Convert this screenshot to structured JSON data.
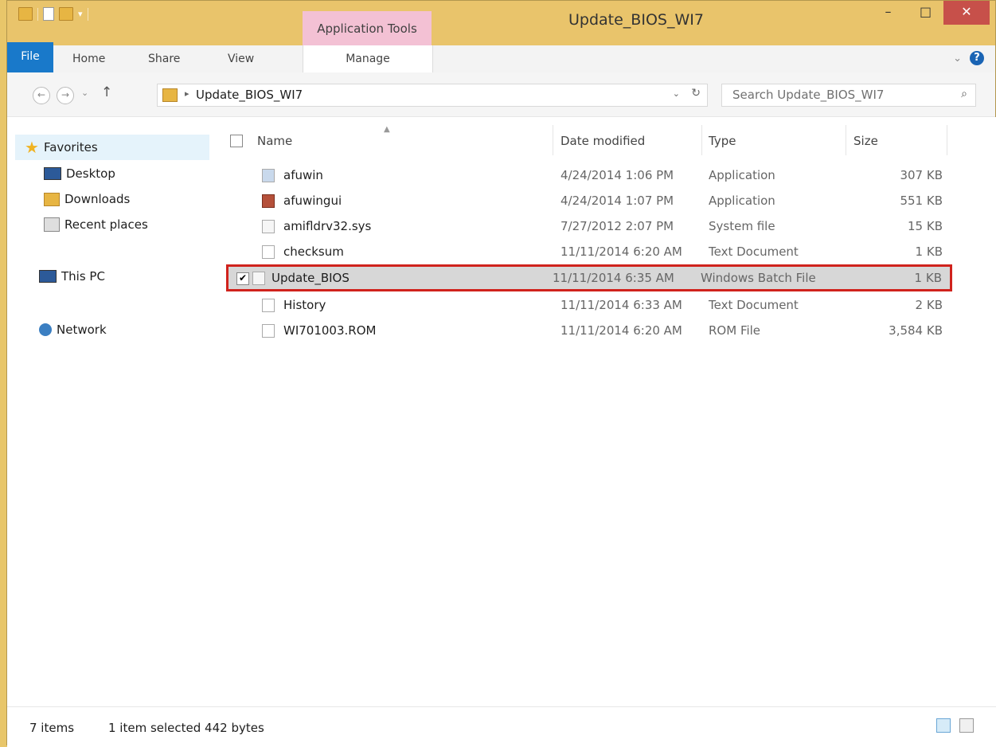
{
  "window": {
    "title": "Update_BIOS_WI7",
    "contextual_tab_group": "Application Tools",
    "controls": {
      "minimize": "–",
      "maximize": "□",
      "close": "✕"
    }
  },
  "ribbon": {
    "tabs": [
      {
        "label": "File"
      },
      {
        "label": "Home"
      },
      {
        "label": "Share"
      },
      {
        "label": "View"
      },
      {
        "label": "Manage"
      }
    ],
    "help": "?",
    "expand": "⌄"
  },
  "address": {
    "back": "←",
    "forward": "→",
    "recent": "⌄",
    "up": "↑",
    "breadcrumb_sep": "▸",
    "path": "Update_BIOS_WI7",
    "dropdown": "⌄",
    "refresh": "↻"
  },
  "search": {
    "placeholder": "Search Update_BIOS_WI7",
    "icon": "⌕"
  },
  "nav_pane": {
    "favorites": "Favorites",
    "items": [
      {
        "label": "Desktop"
      },
      {
        "label": "Downloads"
      },
      {
        "label": "Recent places"
      }
    ],
    "this_pc": "This PC",
    "network": "Network"
  },
  "columns": {
    "name": "Name",
    "date": "Date modified",
    "type": "Type",
    "size": "Size"
  },
  "files": [
    {
      "name": "afuwin",
      "date": "4/24/2014 1:06 PM",
      "type": "Application",
      "size": "307 KB"
    },
    {
      "name": "afuwingui",
      "date": "4/24/2014 1:07 PM",
      "type": "Application",
      "size": "551 KB"
    },
    {
      "name": "amifldrv32.sys",
      "date": "7/27/2012 2:07 PM",
      "type": "System file",
      "size": "15 KB"
    },
    {
      "name": "checksum",
      "date": "11/11/2014 6:20 AM",
      "type": "Text Document",
      "size": "1 KB"
    },
    {
      "name": "Update_BIOS",
      "date": "11/11/2014 6:35 AM",
      "type": "Windows Batch File",
      "size": "1 KB",
      "selected": true
    },
    {
      "name": "History",
      "date": "11/11/2014 6:33 AM",
      "type": "Text Document",
      "size": "2 KB"
    },
    {
      "name": "WI701003.ROM",
      "date": "11/11/2014 6:20 AM",
      "type": "ROM File",
      "size": "3,584 KB"
    }
  ],
  "status": {
    "items": "7 items",
    "selection": "1 item selected 442 bytes"
  },
  "colors": {
    "frame": "#e9c46b",
    "file_tab": "#1979ca",
    "contextual_tab": "#f3c1d4",
    "close_button": "#c7504a",
    "selection_outline": "#d0221c"
  }
}
